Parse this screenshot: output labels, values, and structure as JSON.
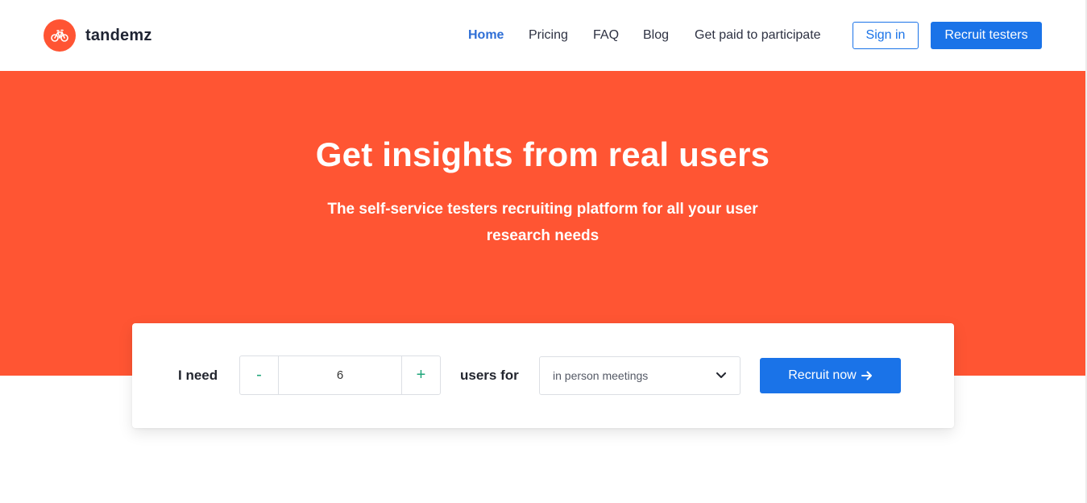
{
  "brand": {
    "name": "tandemz",
    "logo_icon": "bicycle-icon",
    "color": "#ff5433"
  },
  "nav": {
    "items": [
      {
        "label": "Home",
        "active": true
      },
      {
        "label": "Pricing",
        "active": false
      },
      {
        "label": "FAQ",
        "active": false
      },
      {
        "label": "Blog",
        "active": false
      },
      {
        "label": "Get paid to participate",
        "active": false
      }
    ],
    "signin_label": "Sign in",
    "recruit_label": "Recruit testers"
  },
  "hero": {
    "title": "Get insights from real users",
    "subtitle": "The self-service testers recruiting platform for all your user research needs",
    "background": "#ff5533"
  },
  "recruit_form": {
    "prefix_label": "I need",
    "decrement_label": "-",
    "quantity": "6",
    "increment_label": "+",
    "middle_label": "users for",
    "purpose_selected": "in person meetings",
    "submit_label": "Recruit now",
    "submit_icon": "arrow-right-icon"
  },
  "colors": {
    "accent": "#1a73e8",
    "stepper": "#1fa67a"
  }
}
